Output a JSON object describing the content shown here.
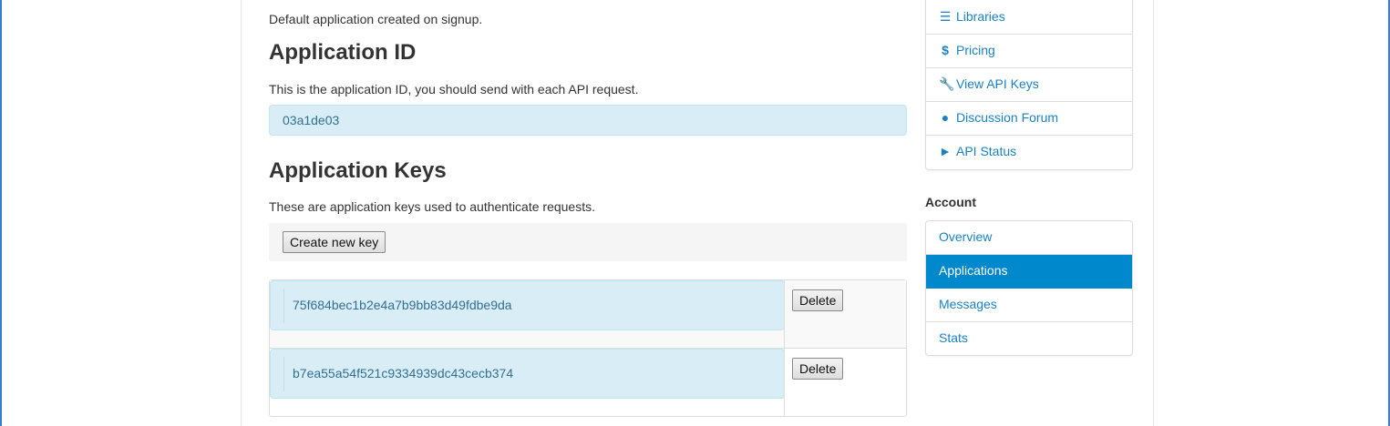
{
  "main": {
    "default_desc": "Default application created on signup.",
    "app_id_heading": "Application ID",
    "app_id_desc": "This is the application ID, you should send with each API request.",
    "app_id_value": "03a1de03",
    "app_keys_heading": "Application Keys",
    "app_keys_desc": "These are application keys used to authenticate requests.",
    "create_key_label": "Create new key",
    "keys": [
      {
        "value": "75f684bec1b2e4a7b9bb83d49fdbe9da",
        "delete_label": "Delete"
      },
      {
        "value": "b7ea55a54f521c9334939dc43cecb374",
        "delete_label": "Delete"
      }
    ]
  },
  "sidebar": {
    "top_items": [
      {
        "label": "Libraries",
        "icon": "list-icon"
      },
      {
        "label": "Pricing",
        "icon": "dollar-icon"
      },
      {
        "label": "View API Keys",
        "icon": "wrench-icon"
      },
      {
        "label": "Discussion Forum",
        "icon": "comment-icon"
      },
      {
        "label": "API Status",
        "icon": "bullhorn-icon"
      }
    ],
    "account_title": "Account",
    "account_items": [
      {
        "label": "Overview",
        "active": false
      },
      {
        "label": "Applications",
        "active": true
      },
      {
        "label": "Messages",
        "active": false
      },
      {
        "label": "Stats",
        "active": false
      }
    ]
  },
  "colors": {
    "link": "#1a82c4",
    "active_bg": "#0088cc",
    "info_bg": "#d9edf7",
    "info_text": "#31708f"
  }
}
